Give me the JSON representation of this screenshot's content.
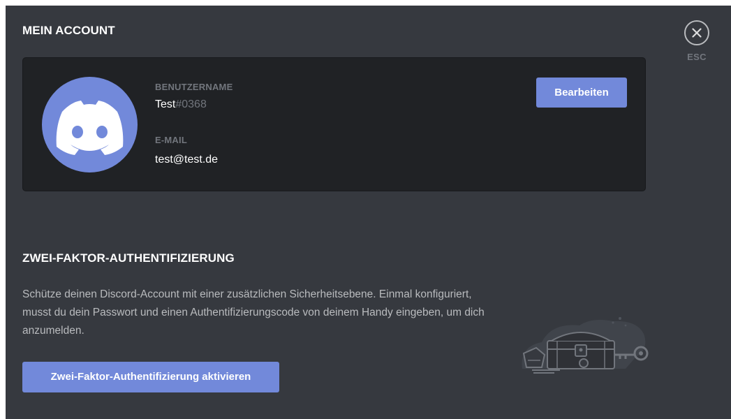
{
  "header": {
    "title": "MEIN ACCOUNT",
    "close_icon": "close-icon",
    "esc_label": "ESC"
  },
  "account": {
    "avatar_icon": "discord-logo-icon",
    "avatar_color": "#7289da",
    "username_label": "BENUTZERNAME",
    "username": "Test",
    "discriminator": "#0368",
    "email_label": "E-MAIL",
    "email": "test@test.de",
    "edit_button": "Bearbeiten"
  },
  "two_factor": {
    "title": "ZWEI-FAKTOR-AUTHENTIFIZIERUNG",
    "description": "Schütze deinen Discord-Account mit einer zusätzlichen Sicherheitsebene. Einmal konfiguriert, musst du dein Passwort und einen Authentifizierungscode von deinem Handy eingeben, um dich anzumelden.",
    "enable_button": "Zwei-Faktor-Authentifizierung aktivieren",
    "illustration_icon": "treasure-chest-key-icon"
  },
  "colors": {
    "background": "#36393f",
    "card": "#202225",
    "accent": "#7289da",
    "muted_text": "#72767d",
    "body_text": "#b9bbbe"
  }
}
